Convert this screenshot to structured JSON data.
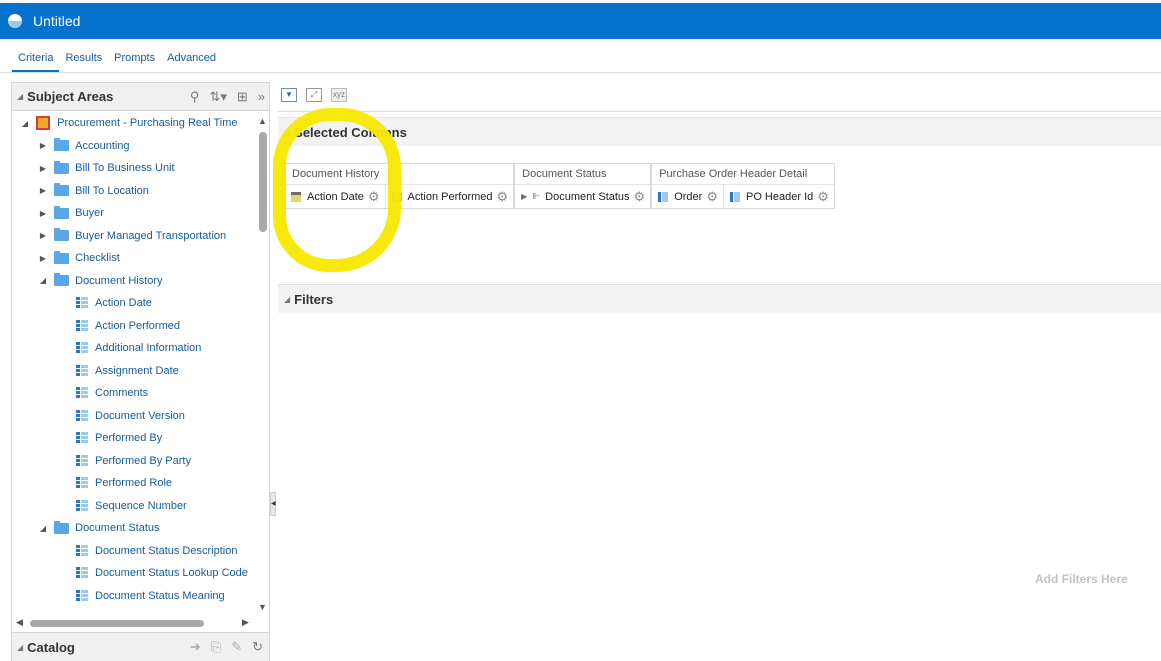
{
  "app": {
    "title": "Untitled"
  },
  "tabs": [
    "Criteria",
    "Results",
    "Prompts",
    "Advanced"
  ],
  "subject_areas": {
    "title": "Subject Areas",
    "root": "Procurement - Purchasing Real Time",
    "folders_top": [
      "Accounting",
      "Bill To Business Unit",
      "Bill To Location",
      "Buyer",
      "Buyer Managed Transportation",
      "Checklist"
    ],
    "document_history": {
      "label": "Document History",
      "columns": [
        "Action Date",
        "Action Performed",
        "Additional Information",
        "Assignment Date",
        "Comments",
        "Document Version",
        "Performed By",
        "Performed By Party",
        "Performed Role",
        "Sequence Number"
      ]
    },
    "document_status": {
      "label": "Document Status",
      "columns": [
        "Document Status Description",
        "Document Status Lookup Code",
        "Document Status Meaning"
      ]
    }
  },
  "catalog": {
    "title": "Catalog"
  },
  "selected_columns": {
    "title": "Selected Columns",
    "groups": [
      {
        "name": "Document History",
        "columns": [
          "Action Date",
          "Action Performed"
        ]
      },
      {
        "name": "Document Status",
        "columns": [
          "Document Status"
        ]
      },
      {
        "name": "Purchase Order Header Detail",
        "columns": [
          "Order",
          "PO Header Id"
        ]
      }
    ]
  },
  "filters": {
    "title": "Filters",
    "empty_text": "Add Filters Here"
  },
  "colors": {
    "titlebar": "#0572ce",
    "link": "#145c9e",
    "highlight": "#f8e800"
  }
}
